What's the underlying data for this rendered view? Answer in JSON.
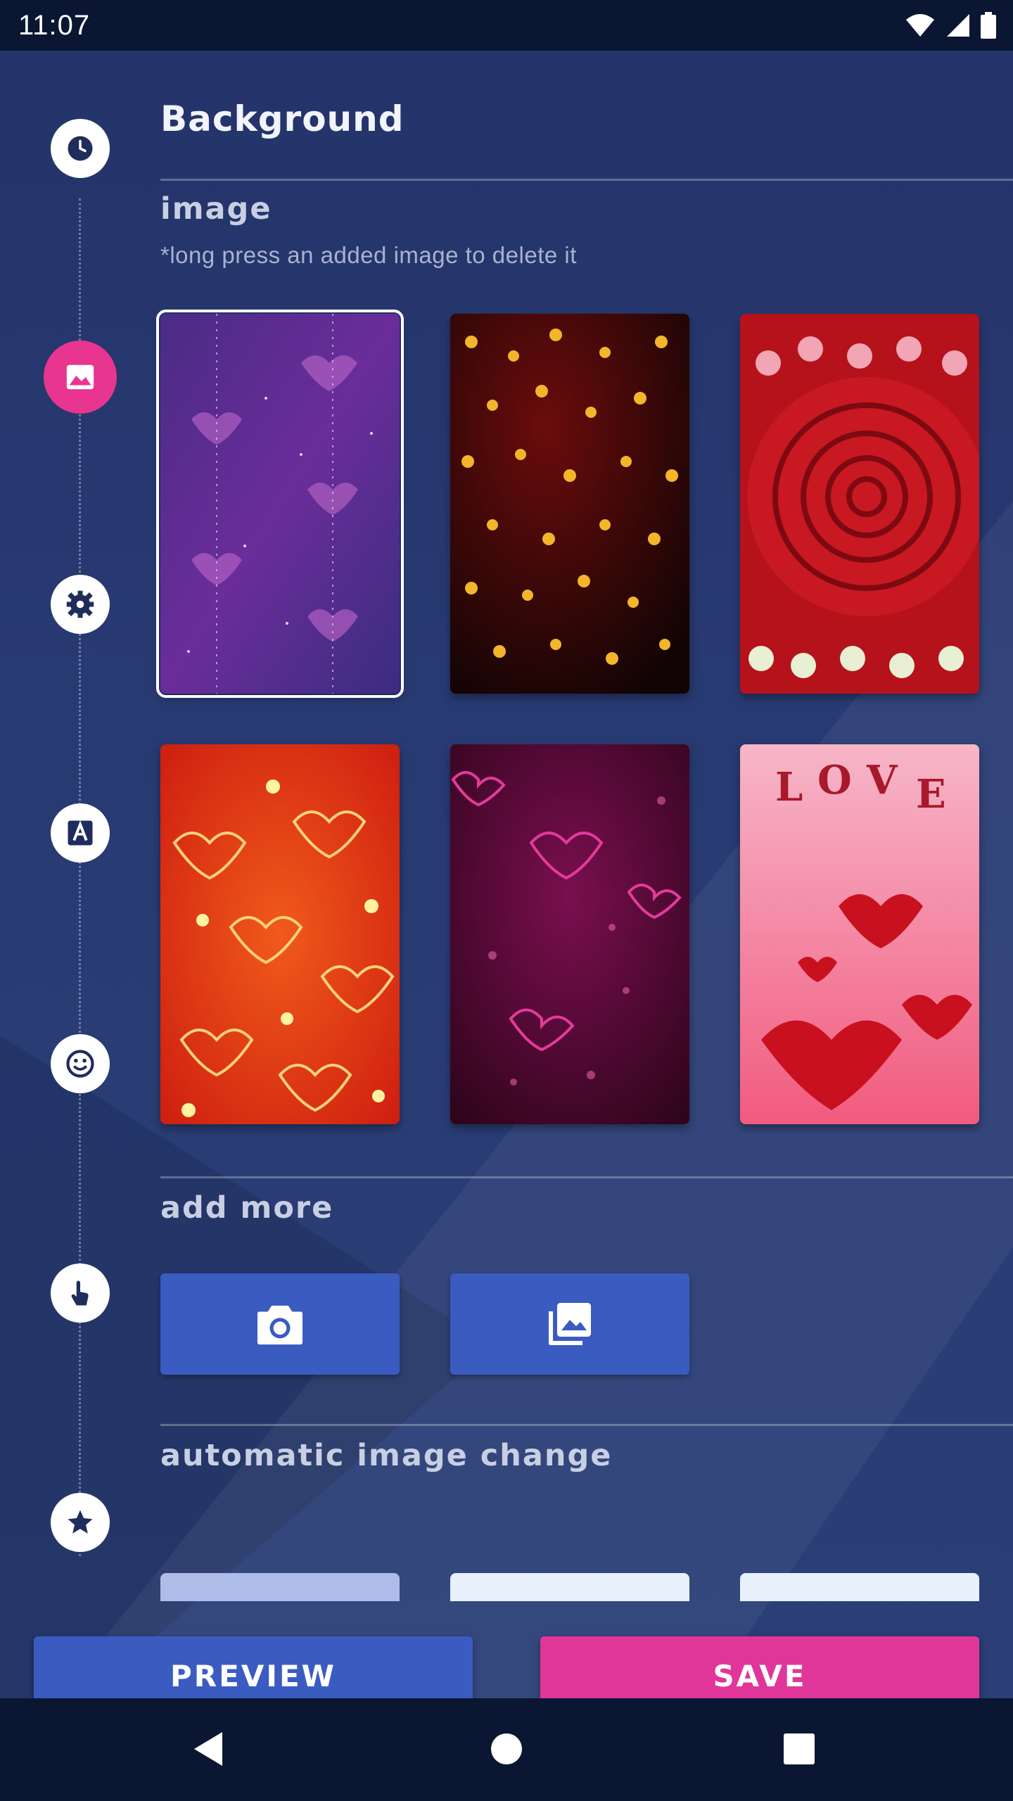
{
  "status_bar": {
    "time": "11:07",
    "icons": [
      "wifi-icon",
      "signal-icon",
      "battery-icon"
    ]
  },
  "header": {
    "title": "Background"
  },
  "timeline": {
    "steps": [
      "clock-icon",
      "image-icon",
      "settings-icon",
      "text-icon",
      "emoji-icon",
      "touch-icon",
      "star-icon"
    ],
    "active_step": "image-icon",
    "active_color": "#e8358f"
  },
  "image_section": {
    "title": "image",
    "hint": "*long press an added image to delete it",
    "thumbnails": [
      {
        "name": "purple-hearts-sparkles",
        "selected": true
      },
      {
        "name": "golden-hearts-dark",
        "selected": false
      },
      {
        "name": "red-rose-flowers",
        "selected": false
      },
      {
        "name": "orange-sparkle-hearts",
        "selected": false
      },
      {
        "name": "magenta-glitter-hearts",
        "selected": false
      },
      {
        "name": "love-red-hearts-pink",
        "selected": false
      }
    ]
  },
  "add_more_section": {
    "title": "add more",
    "buttons": [
      "camera-icon",
      "gallery-icon"
    ]
  },
  "auto_change_section": {
    "title": "automatic image change"
  },
  "actions": {
    "preview_label": "PREVIEW",
    "save_label": "SAVE",
    "preview_color": "#3a5cc1",
    "save_color": "#e0369a"
  },
  "nav_bar": {
    "icons": [
      "back-icon",
      "home-icon",
      "recents-icon"
    ]
  }
}
